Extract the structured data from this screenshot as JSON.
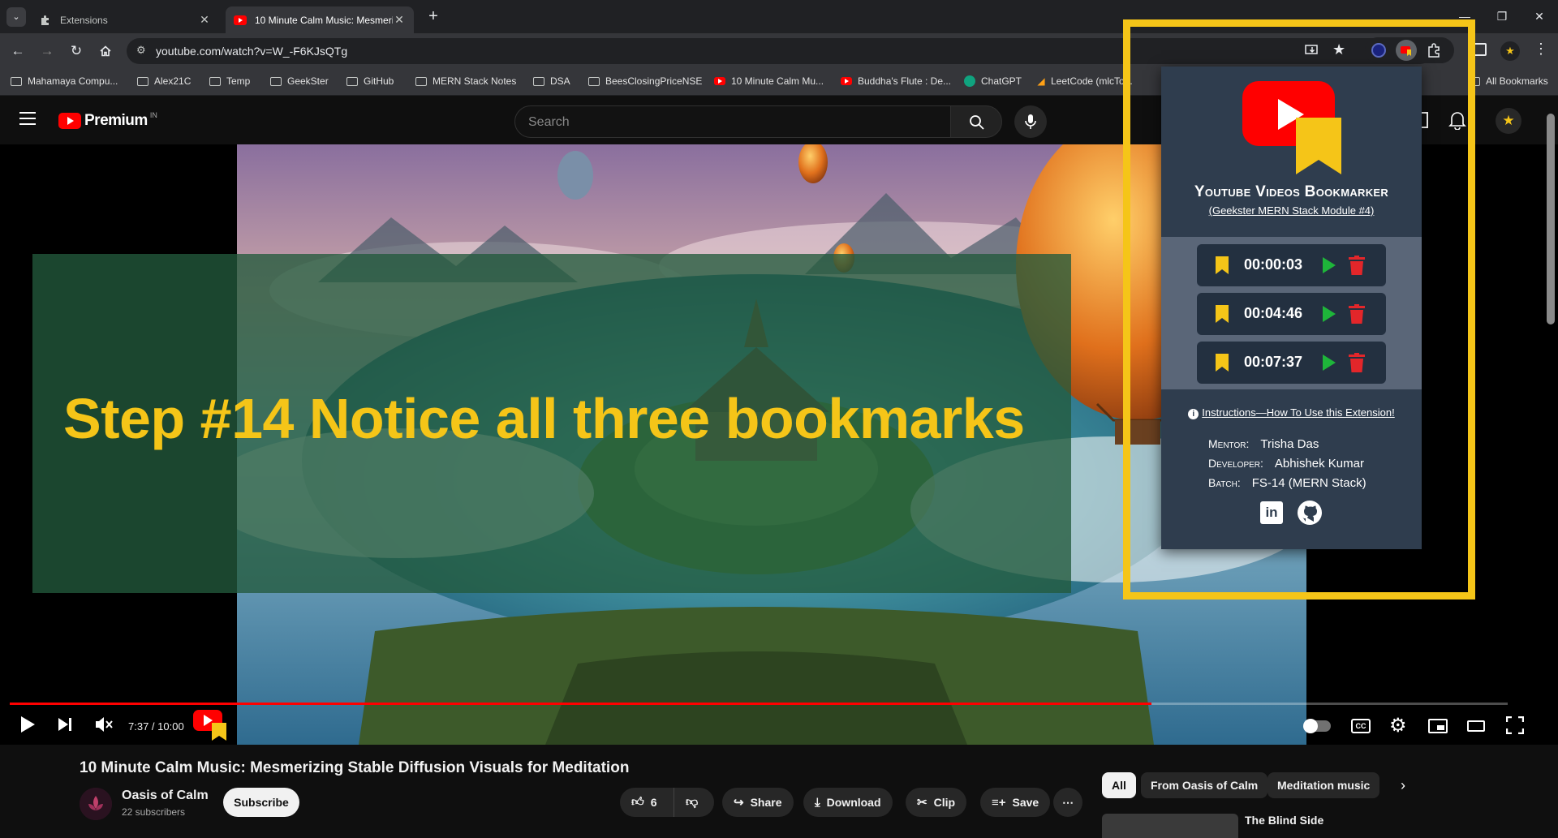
{
  "browser": {
    "tabs": [
      {
        "title": "Extensions"
      },
      {
        "title": "10 Minute Calm Music: Mesmeri"
      }
    ],
    "url": "youtube.com/watch?v=W_-F6KJsQTg",
    "bookmarks": [
      {
        "label": "Mahamaya Compu...",
        "icon": "folder-icon"
      },
      {
        "label": "Alex21C",
        "icon": "folder-icon"
      },
      {
        "label": "Temp",
        "icon": "folder-icon"
      },
      {
        "label": "GeekSter",
        "icon": "folder-icon"
      },
      {
        "label": "GitHub",
        "icon": "folder-icon"
      },
      {
        "label": "MERN Stack Notes",
        "icon": "folder-icon"
      },
      {
        "label": "DSA",
        "icon": "folder-icon"
      },
      {
        "label": "BeesClosingPriceNSE",
        "icon": "folder-icon"
      },
      {
        "label": "10 Minute Calm Mu...",
        "icon": "youtube-icon"
      },
      {
        "label": "Buddha's Flute : De...",
        "icon": "youtube-icon"
      },
      {
        "label": "ChatGPT",
        "icon": "chatgpt-icon"
      },
      {
        "label": "LeetCode (mlcTo...",
        "icon": "leetcode-icon"
      }
    ],
    "all_bookmarks": "All Bookmarks"
  },
  "youtube": {
    "logo_text": "Premium",
    "region": "IN",
    "search_placeholder": "Search"
  },
  "video": {
    "overlay_text": "Step #14 Notice all three bookmarks",
    "time_display": "7:37 / 10:00",
    "progress": 0.762
  },
  "meta": {
    "title": "10 Minute Calm Music: Mesmerizing Stable Diffusion Visuals for Meditation",
    "channel": "Oasis of Calm",
    "subscribers": "22 subscribers",
    "subscribe_label": "Subscribe",
    "likes": "6",
    "share_label": "Share",
    "download_label": "Download",
    "clip_label": "Clip",
    "save_label": "Save"
  },
  "chips": [
    {
      "label": "All",
      "selected": true
    },
    {
      "label": "From Oasis of Calm",
      "selected": false
    },
    {
      "label": "Meditation music",
      "selected": false
    }
  ],
  "related": {
    "title": "The Blind Side"
  },
  "extension": {
    "title": "Youtube Videos Bookmarker",
    "subtitle": "(Geekster MERN Stack Module #4)",
    "bookmarks": [
      {
        "time": "00:00:03"
      },
      {
        "time": "00:04:46"
      },
      {
        "time": "00:07:37"
      }
    ],
    "instructions": "Instructions—How To Use this Extension!",
    "credits": [
      {
        "key": "Mentor:",
        "value": "Trisha Das"
      },
      {
        "key": "Developer:",
        "value": "Abhishek Kumar"
      },
      {
        "key": "Batch:",
        "value": "FS-14 (MERN Stack)"
      }
    ]
  },
  "colors": {
    "highlight": "#f5c518",
    "yt_red": "#ff0000",
    "popup_bg": "#2f3d4e"
  }
}
